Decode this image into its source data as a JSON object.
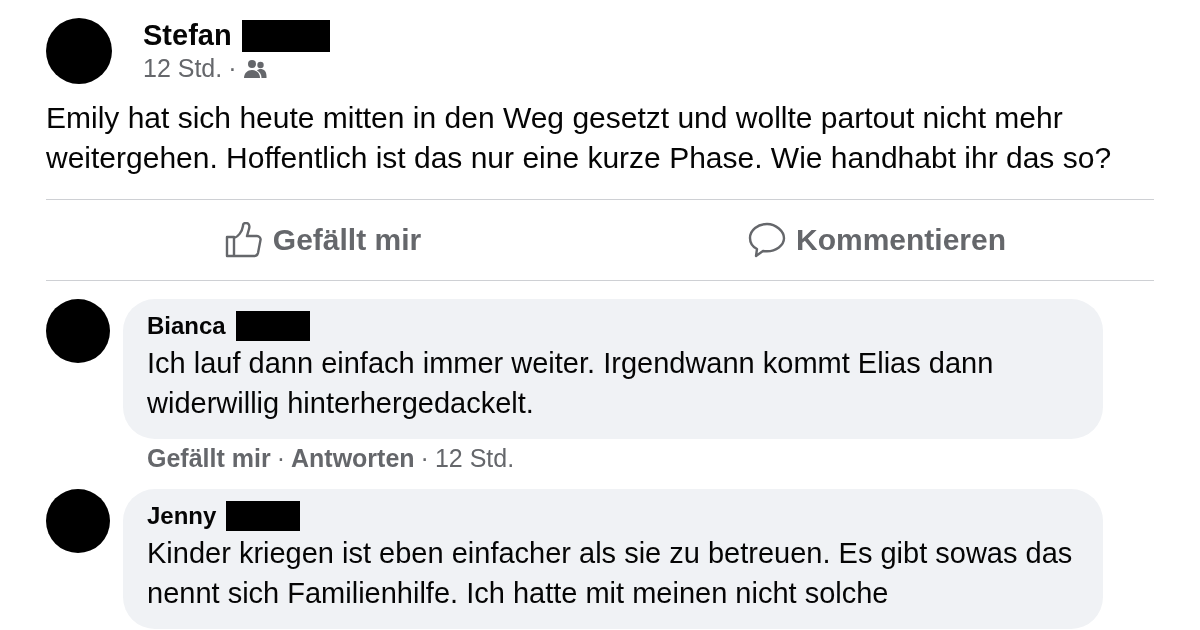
{
  "post": {
    "author": {
      "name": "Stefan",
      "redacted": true
    },
    "time": "12 Std.",
    "separator": "·",
    "text": "Emily hat sich heute mitten in den Weg gesetzt und wollte partout nicht mehr weitergehen. Hoffentlich ist das nur eine kurze Phase. Wie handhabt ihr das so?"
  },
  "actions": [
    {
      "kind": "like",
      "label": "Gefällt mir"
    },
    {
      "kind": "comment",
      "label": "Kommentieren"
    }
  ],
  "comments": [
    {
      "author": {
        "name": "Bianca",
        "redacted": true
      },
      "text": "Ich lauf dann einfach immer weiter. Irgendwann kommt Elias dann widerwillig hinterhergedackelt.",
      "like": "Gefällt mir",
      "separator_1": "·",
      "reply": "Antworten",
      "separator_2": "·",
      "time": "12 Std."
    },
    {
      "author": {
        "name": "Jenny",
        "redacted": true
      },
      "text": "Kinder kriegen ist eben einfacher als sie zu betreuen. Es gibt sowas das nennt sich Familienhilfe. Ich hatte mit meinen nicht solche"
    }
  ]
}
